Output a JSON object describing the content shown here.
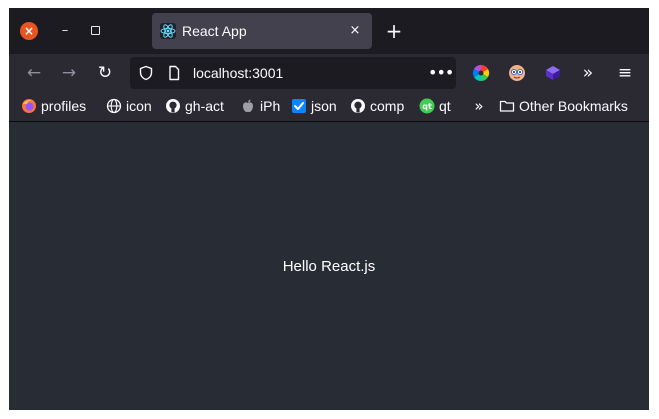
{
  "window": {
    "controls": {
      "close": "×",
      "minimize": "–"
    }
  },
  "tab": {
    "title": "React App",
    "favicon": "react-icon",
    "close": "×",
    "new_tab": "+"
  },
  "nav": {
    "back": "←",
    "forward": "→",
    "reload": "↻",
    "url": "localhost:3001",
    "page_actions": "•••",
    "overflow": "»",
    "menu": "≡",
    "extensions": [
      "color-wheel-icon",
      "face-extension-icon",
      "purple-cube-icon"
    ]
  },
  "bookmarks": {
    "items": [
      {
        "label": "profiles",
        "icon": "firefox-icon"
      },
      {
        "label": "icon",
        "icon": "globe-icon"
      },
      {
        "label": "gh-act",
        "icon": "github-icon"
      },
      {
        "label": "iPh",
        "icon": "apple-icon"
      },
      {
        "label": "json",
        "icon": "checkbox-icon"
      },
      {
        "label": "comp",
        "icon": "github-icon"
      },
      {
        "label": "qt",
        "icon": "qt-icon"
      }
    ],
    "overflow": "»",
    "other": {
      "label": "Other Bookmarks",
      "icon": "folder-icon"
    }
  },
  "content": {
    "text": "Hello React.js",
    "background": "#282c34"
  }
}
